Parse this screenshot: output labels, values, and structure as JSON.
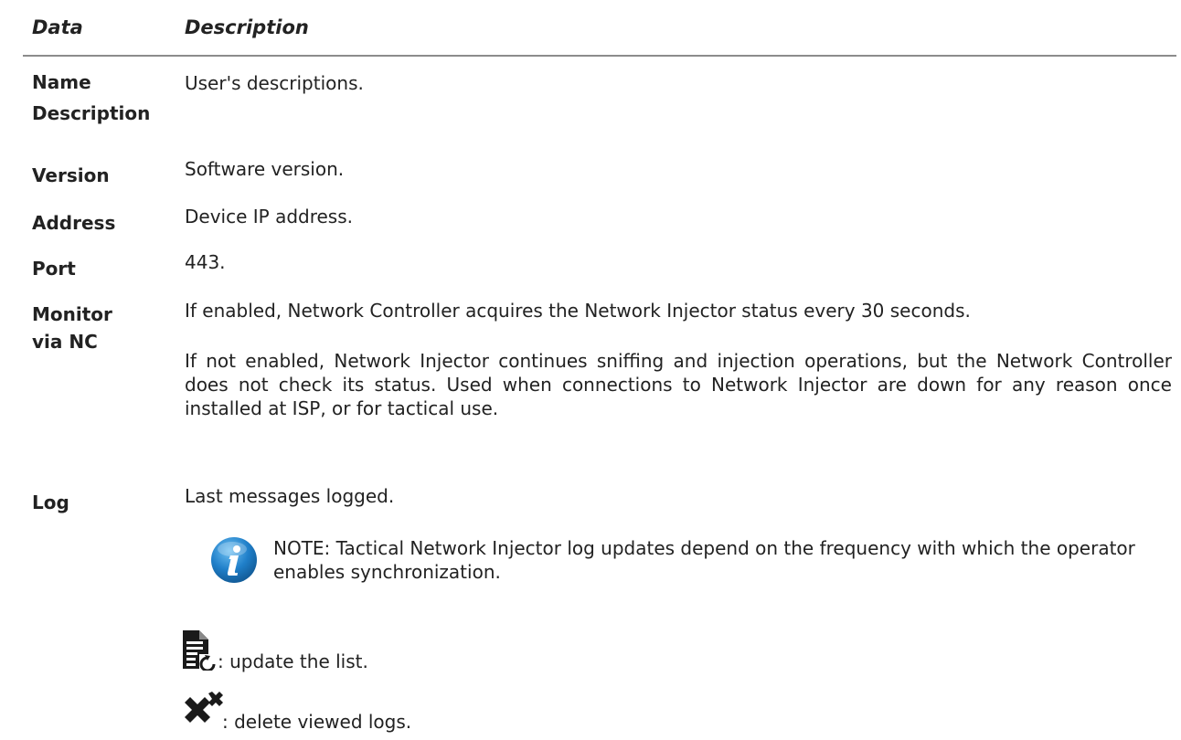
{
  "table": {
    "header": {
      "data": "Data",
      "description": "Description"
    },
    "rows": [
      {
        "term_line1": "Name",
        "term_line2": "Description",
        "definition": "User's descriptions."
      },
      {
        "term": "Version",
        "definition": "Software version."
      },
      {
        "term": "Address",
        "definition": "Device IP address."
      },
      {
        "term": "Port",
        "definition": "443."
      },
      {
        "term_line1": "Monitor",
        "term_line2": "via NC",
        "definition_p1": "If enabled, Network Controller acquires the Network Injector status every 30 seconds.",
        "definition_p2": "If not enabled, Network Injector continues sniffing and injection operations, but the Network Controller does not check its status. Used when connections to Network Injector are down for any reason once installed at ISP, or for tactical use."
      },
      {
        "term": "Log",
        "definition": "Last messages logged.",
        "note": "NOTE: Tactical Network Injector log updates depend on the frequency with which the operator enables synchronization.",
        "actions": [
          {
            "icon": "refresh-list-icon",
            "label": ": update the list."
          },
          {
            "icon": "delete-logs-icon",
            "label": ": delete viewed logs."
          }
        ]
      }
    ]
  },
  "colors": {
    "rule": "#8c8c8c",
    "info_blue": "#1f7fc9",
    "text": "#222222"
  }
}
